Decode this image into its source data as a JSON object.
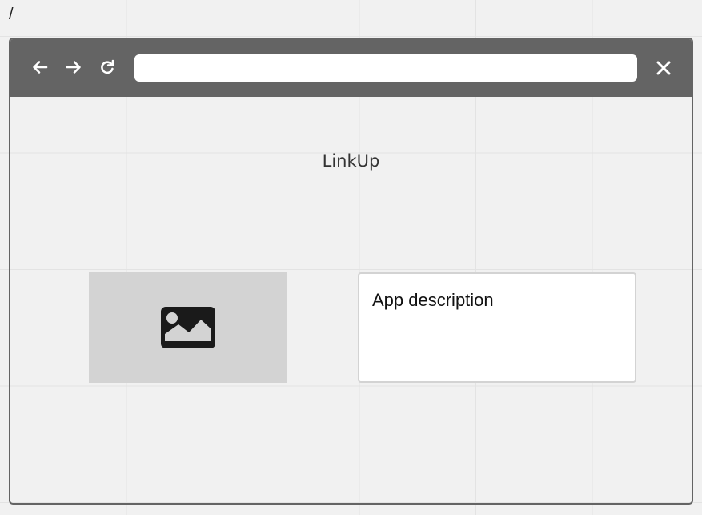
{
  "breadcrumb": "/",
  "browser": {
    "toolbar_color": "#646464",
    "icons": {
      "back": "arrow-left-icon",
      "forward": "arrow-right-icon",
      "reload": "reload-icon",
      "close": "close-icon"
    },
    "address_value": ""
  },
  "app": {
    "title": "LinkUp",
    "image_icon": "image-icon",
    "description": "App description"
  }
}
